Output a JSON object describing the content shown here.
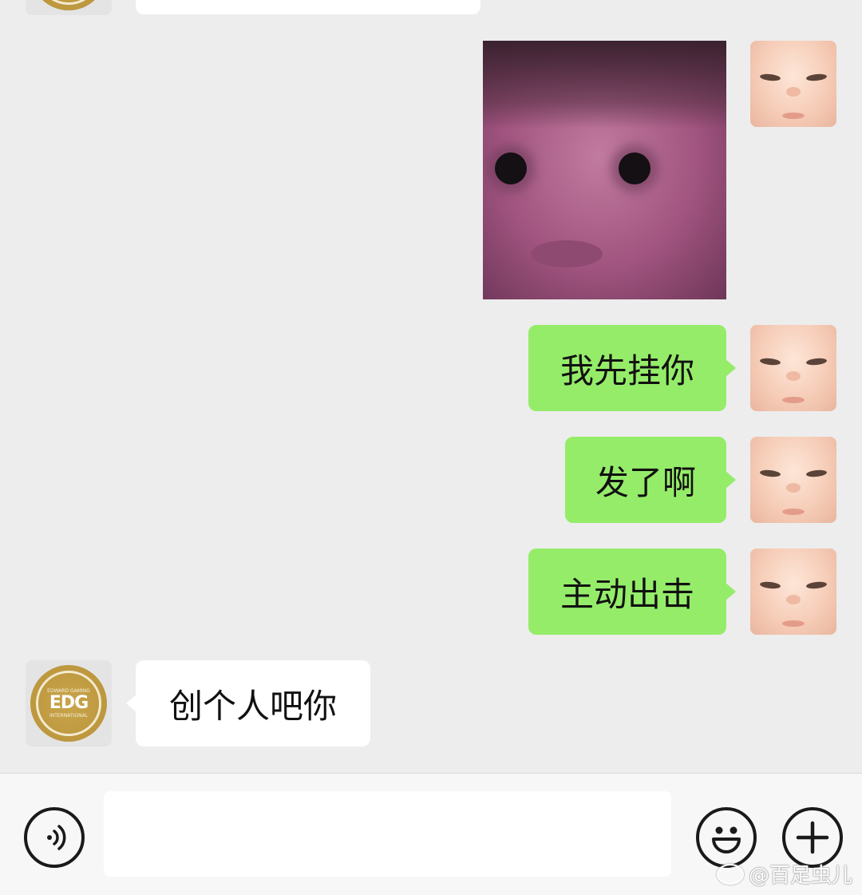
{
  "colors": {
    "background": "#ededed",
    "outgoing_bubble": "#95ec69",
    "incoming_bubble": "#ffffff",
    "input_bar": "#f7f7f7"
  },
  "messages": {
    "outgoing_1": "我先挂你",
    "outgoing_2": "发了啊",
    "outgoing_3": "主动出击",
    "incoming_1": "创个人吧你"
  },
  "avatars": {
    "contact_logo_top": "EDWARD GAMING",
    "contact_logo_main": "EDG",
    "contact_logo_bottom": "INTERNATIONAL"
  },
  "input": {
    "value": "",
    "voice_icon": "voice-icon",
    "emoji_icon": "emoji-icon",
    "plus_icon": "plus-icon"
  },
  "watermark": {
    "text": "@百足虫儿"
  }
}
